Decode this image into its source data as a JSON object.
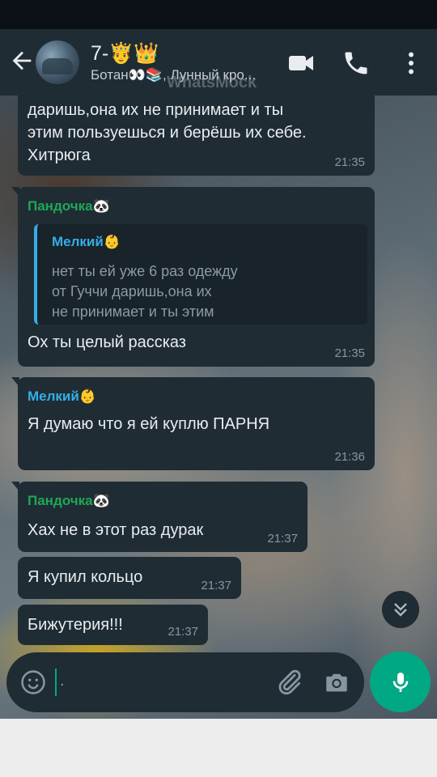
{
  "header": {
    "title": "7-🤴👑",
    "subtitle": "Ботан👀📚, Лунный кро...",
    "watermark": "WhatsMock"
  },
  "messages": [
    {
      "text": "даришь,она их не принимает и ты\nэтим пользуешься и берёшь их себе.\nХитрюга",
      "time": "21:35"
    },
    {
      "sender": "Пандочка🐼",
      "sender_color": "#1fa855",
      "quote": {
        "name": "Мелкий👶",
        "text": "нет ты ей уже 6 раз одежду\nот Гуччи даришь,она их\nне принимает и ты этим"
      },
      "text": "Ох ты целый рассказ",
      "time": "21:35"
    },
    {
      "sender": "Мелкий👶",
      "sender_color": "#35aee6",
      "text": "Я думаю что я ей куплю ПАРНЯ",
      "time": "21:36"
    },
    {
      "sender": "Пандочка🐼",
      "sender_color": "#1fa855",
      "text": "Хах не в этот раз дурак",
      "time": "21:37"
    },
    {
      "text": "Я купил кольцо",
      "time": "21:37"
    },
    {
      "text": "Бижутерия!!!",
      "time": "21:37"
    }
  ],
  "input": {
    "placeholder": "."
  },
  "colors": {
    "accent": "#00a884",
    "bubble": "#1f2c34",
    "header": "#1f2c34",
    "quote_accent": "#35aee6"
  },
  "icons": [
    "back-arrow-icon",
    "video-call-icon",
    "phone-icon",
    "more-options-icon",
    "chevron-down-icon",
    "emoji-icon",
    "attach-icon",
    "camera-icon",
    "mic-icon"
  ]
}
